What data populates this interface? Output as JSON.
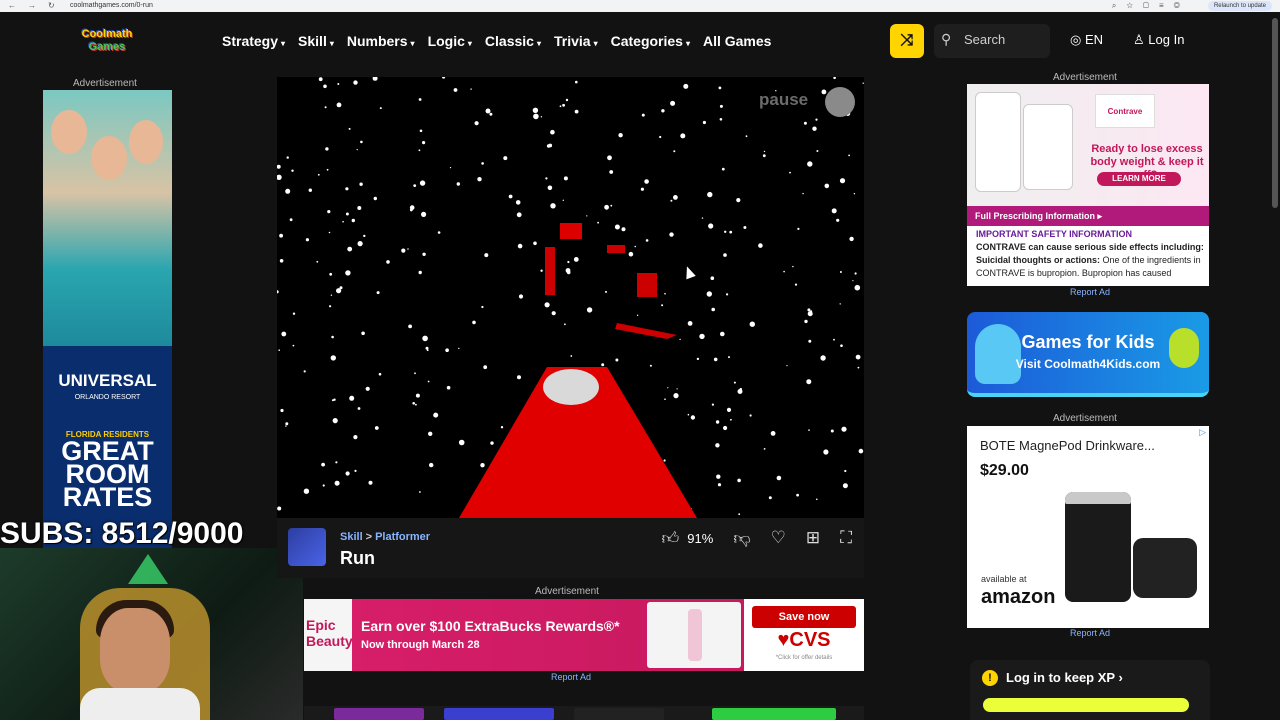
{
  "browser": {
    "url": "coolmathgames.com/0-run",
    "relaunch_label": "Relaunch to update"
  },
  "header": {
    "logo_line1": "Coolmath",
    "logo_line2": "Games",
    "menu": [
      {
        "label": "Strategy"
      },
      {
        "label": "Skill"
      },
      {
        "label": "Numbers"
      },
      {
        "label": "Logic"
      },
      {
        "label": "Classic"
      },
      {
        "label": "Trivia"
      },
      {
        "label": "Categories"
      },
      {
        "label": "All Games"
      }
    ],
    "search_placeholder": "Search",
    "language": "EN",
    "login_label": "Log In"
  },
  "left_ad": {
    "label": "Advertisement",
    "brand": "UNIVERSAL",
    "brand_sub": "ORLANDO RESORT",
    "tagline": "FLORIDA RESIDENTS",
    "headline_1": "GREAT",
    "headline_2": "ROOM",
    "headline_3": "RATES"
  },
  "overlay": {
    "subs_text": "SUBS: 8512/9000"
  },
  "game": {
    "pause_label": "pause",
    "category": "Skill",
    "subcategory": "Platformer",
    "title": "Run",
    "rating": "91%"
  },
  "banner_ad": {
    "label": "Advertisement",
    "brand_left": "Epic Beauty",
    "headline": "Earn over $100 ExtraBucks Rewards®*",
    "subline": "Now through March 28",
    "cta": "Save now",
    "cvs_logo": "♥CVS",
    "fine_print": "*Click for offer details",
    "report": "Report Ad"
  },
  "right_column": {
    "ad1_label": "Advertisement",
    "contrave": {
      "brand": "Contrave",
      "headline": "Ready to lose excess body weight & keep it off?",
      "cta": "LEARN MORE",
      "pi_link": "Full Prescribing Information",
      "isi_title": "IMPORTANT SAFETY INFORMATION",
      "isi_line1": "CONTRAVE can cause serious side effects including:",
      "isi_line2_bold": "Suicidal thoughts or actions:",
      "isi_line2": " One of the ingredients in CONTRAVE is bupropion. Bupropion has caused"
    },
    "report1": "Report Ad",
    "kids": {
      "title": "Games for Kids",
      "subtitle": "Visit Coolmath4Kids.com"
    },
    "ad2_label": "Advertisement",
    "bote": {
      "title": "BOTE MagnePod Drinkware...",
      "price": "$29.00",
      "available": "available at",
      "retailer": "amazon"
    },
    "report2": "Report Ad",
    "xp_label": "Log in to keep XP"
  }
}
